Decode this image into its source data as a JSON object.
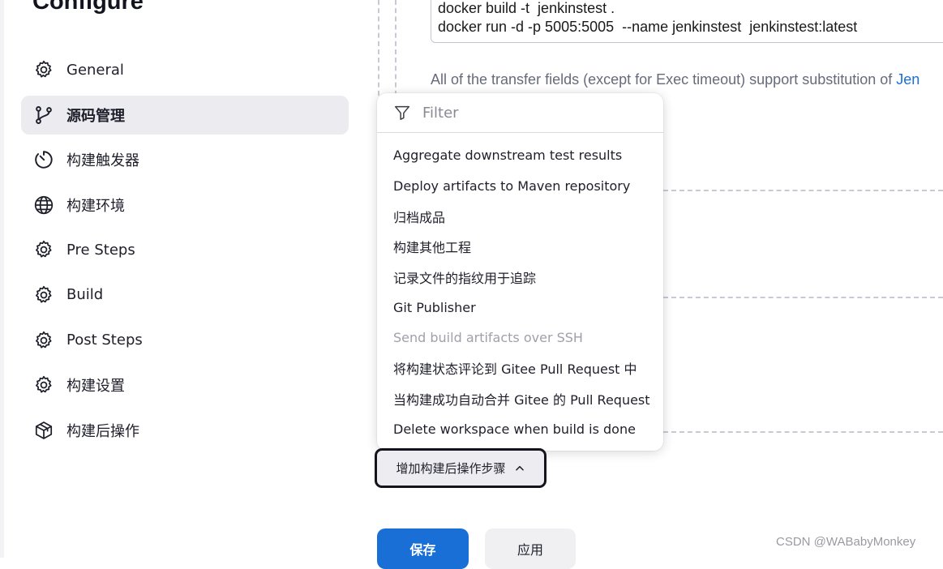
{
  "page": {
    "title": "Configure"
  },
  "sidebar": {
    "items": [
      {
        "label": "General",
        "icon": "gear-icon",
        "active": false
      },
      {
        "label": "源码管理",
        "icon": "git-branch-icon",
        "active": true
      },
      {
        "label": "构建触发器",
        "icon": "timer-icon",
        "active": false
      },
      {
        "label": "构建环境",
        "icon": "globe-icon",
        "active": false
      },
      {
        "label": "Pre Steps",
        "icon": "gear-icon",
        "active": false
      },
      {
        "label": "Build",
        "icon": "gear-icon",
        "active": false
      },
      {
        "label": "Post Steps",
        "icon": "gear-icon",
        "active": false
      },
      {
        "label": "构建设置",
        "icon": "gear-icon",
        "active": false
      },
      {
        "label": "构建后操作",
        "icon": "package-icon",
        "active": false
      }
    ]
  },
  "exec_command": {
    "lines": [
      "docker build -t  jenkinstest .",
      "docker run -d -p 5005:5005  --name jenkinstest  jenkinstest:latest"
    ]
  },
  "help": {
    "text": "All of the transfer fields (except for Exec timeout) support substitution of ",
    "link": "Jen"
  },
  "dropdown": {
    "filter_placeholder": "Filter",
    "items": [
      {
        "label": "Aggregate downstream test results",
        "disabled": false
      },
      {
        "label": "Deploy artifacts to Maven repository",
        "disabled": false
      },
      {
        "label": "归档成品",
        "disabled": false
      },
      {
        "label": "构建其他工程",
        "disabled": false
      },
      {
        "label": "记录文件的指纹用于追踪",
        "disabled": false
      },
      {
        "label": "Git Publisher",
        "disabled": false
      },
      {
        "label": "Send build artifacts over SSH",
        "disabled": true
      },
      {
        "label": "将构建状态评论到 Gitee Pull Request 中",
        "disabled": false
      },
      {
        "label": "当构建成功自动合并 Gitee 的 Pull Request",
        "disabled": false
      },
      {
        "label": "Delete workspace when build is done",
        "disabled": false
      }
    ]
  },
  "buttons": {
    "add_step": "增加构建后操作步骤",
    "save": "保存",
    "apply": "应用"
  },
  "watermark": "CSDN @WABabyMonkey",
  "colors": {
    "accent": "#1a6fd6",
    "active_bg": "#ebebf0"
  }
}
